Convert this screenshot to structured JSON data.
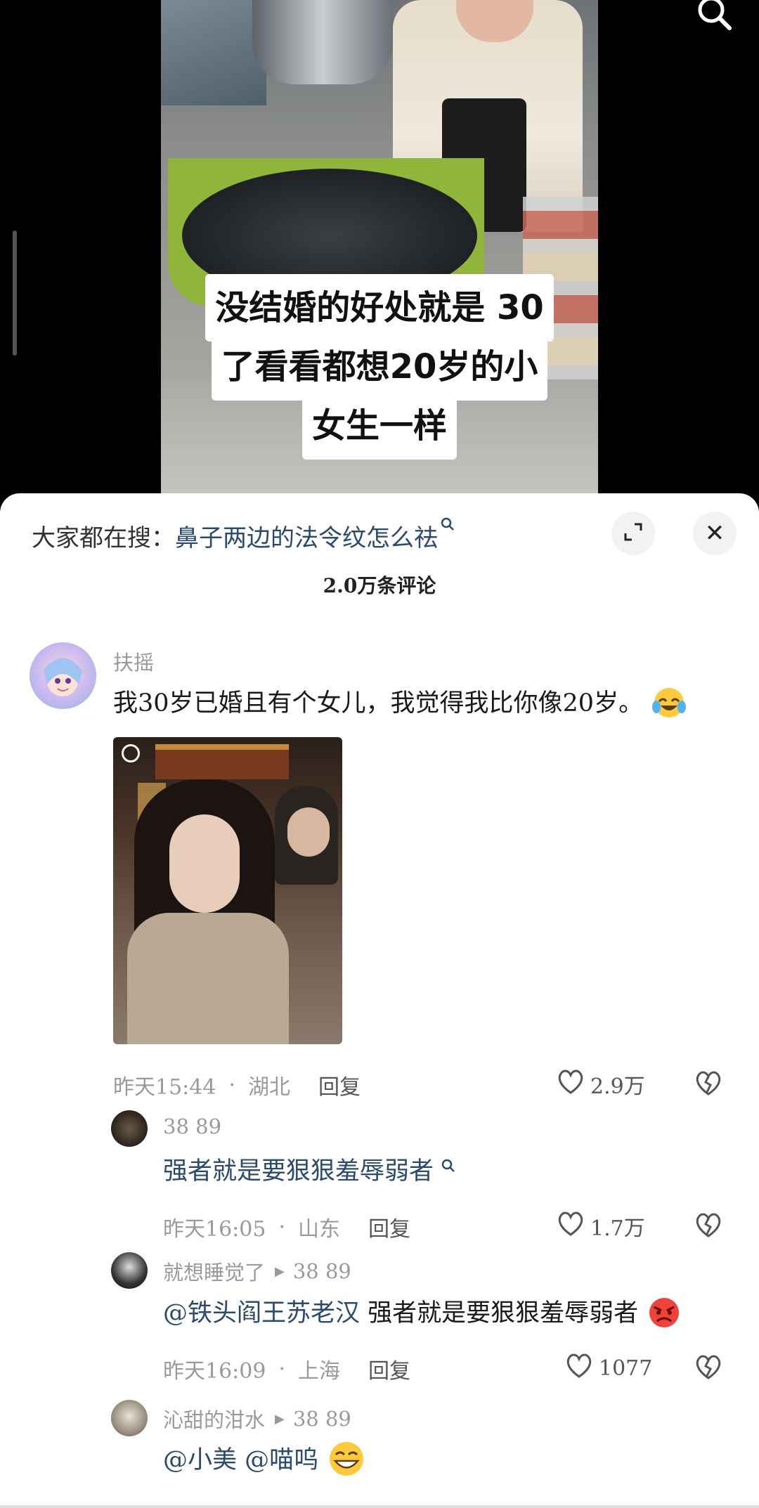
{
  "video": {
    "caption_lines": [
      "没结婚的好处就是 30",
      "了看看都想20岁的小",
      "女生一样"
    ],
    "search_icon": "search-icon"
  },
  "sheet": {
    "search_label": "大家都在搜：",
    "search_query": "鼻子两边的法令纹怎么祛",
    "comment_count": "2.0万条评论",
    "icons": {
      "expand": "expand-icon",
      "close": "close-icon",
      "close_glyph": "✕"
    }
  },
  "comments": [
    {
      "user": "扶摇",
      "text": "我30岁已婚且有个女儿，我觉得我比你像20岁。",
      "emoji": "crying-laughing-emoji",
      "has_photo": true,
      "time": "昨天15:44",
      "location": "湖北",
      "reply": "回复",
      "likes": "2.9万"
    },
    {
      "user": "38 89",
      "text": "强者就是要狠狠羞辱弱者",
      "text_is_search_link": true,
      "time": "昨天16:05",
      "location": "山东",
      "reply": "回复",
      "likes": "1.7万"
    },
    {
      "user": "就想睡觉了",
      "reply_to": "38 89",
      "mention": "@铁头阎王苏老汉",
      "text": " 强者就是要狠狠羞辱弱者",
      "emoji": "angry-face-emoji",
      "time": "昨天16:09",
      "location": "上海",
      "reply": "回复",
      "likes": "1077"
    },
    {
      "user": "沁甜的泔水",
      "reply_to": "38 89",
      "mention": "@小美 @喵呜",
      "emoji": "grinning-face-emoji"
    }
  ],
  "dot": "·",
  "colors": {
    "link": "#2b4a70",
    "muted": "#9a9a9a",
    "sheet_bg": "#ffffff"
  }
}
